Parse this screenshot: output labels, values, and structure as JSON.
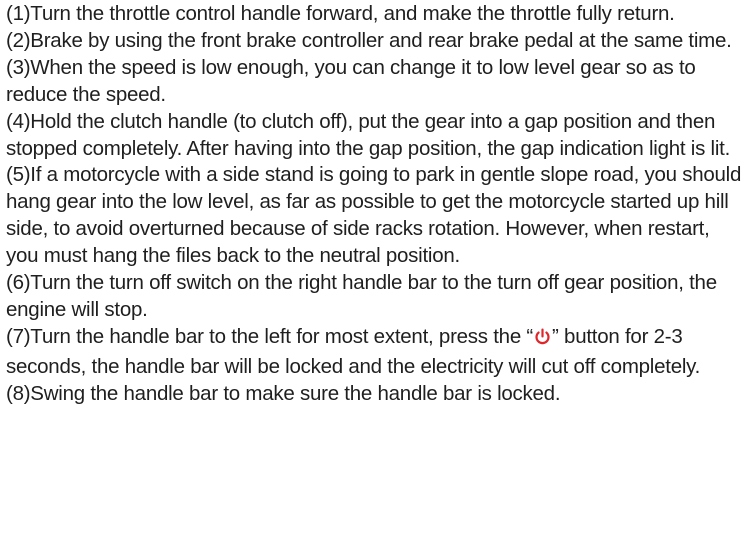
{
  "steps": [
    {
      "text": "(1)Turn the throttle control handle forward, and make the throttle fully return."
    },
    {
      "text": "(2)Brake by using the front brake controller and rear brake pedal at the same time."
    },
    {
      "text": "(3)When the speed is low enough, you can change it to low level gear so as to reduce the speed."
    },
    {
      "text": "(4)Hold the clutch handle (to clutch off), put the gear into a gap position and then stopped completely. After having into the gap position, the gap indication light is lit."
    },
    {
      "text": "(5)If a motorcycle with a side stand is going to park in gentle slope road, you should hang gear into the low level, as far as possible to get the motorcycle started up hill side, to avoid overturned because of side racks rotation. However, when restart, you must hang the files back to the neutral position."
    },
    {
      "text": "(6)Turn the turn off switch on the right handle bar to the turn off gear position, the engine will stop."
    },
    {
      "text_before": "(7)Turn the handle bar to the left for most extent, press the “",
      "icon": "power-icon",
      "text_after": "” button for 2-3 seconds, the handle bar will be locked and the electricity will cut off completely."
    },
    {
      "text": "(8)Swing the handle bar to make sure the handle bar is locked."
    }
  ],
  "colors": {
    "text": "#1f1f1f",
    "power_icon": "#e0262b"
  }
}
